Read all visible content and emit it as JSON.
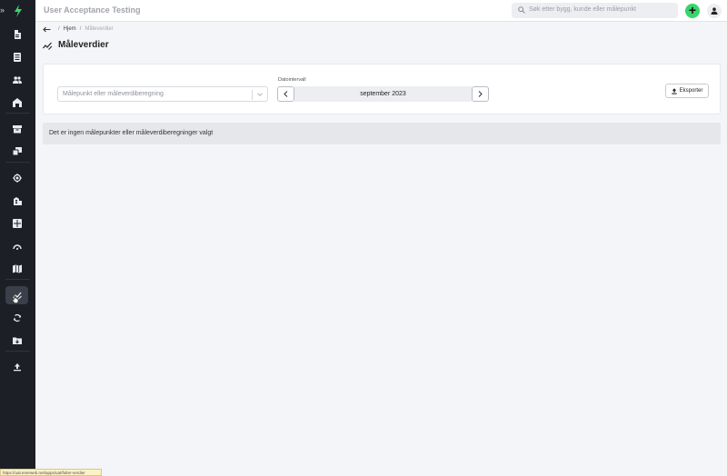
{
  "app": {
    "title": "User Acceptance Testing",
    "accent_color": "#3bd36c"
  },
  "search": {
    "placeholder": "Søk etter bygg, kunde eller målepunkt"
  },
  "topbar": {
    "add_label": "+"
  },
  "sidebar": {
    "expand_label": "»",
    "items": [
      {
        "icon": "document-icon"
      },
      {
        "icon": "list-icon"
      },
      {
        "icon": "people-icon"
      },
      {
        "icon": "building-icon"
      },
      {
        "icon": "archive-icon"
      },
      {
        "icon": "copy-icon"
      },
      {
        "icon": "target-icon"
      },
      {
        "icon": "buildings-icon"
      },
      {
        "icon": "grid-icon"
      },
      {
        "icon": "gauge-icon"
      },
      {
        "icon": "map-icon"
      },
      {
        "icon": "chart-line-icon",
        "active": true
      },
      {
        "icon": "sync-icon"
      },
      {
        "icon": "folder-icon"
      },
      {
        "icon": "upload-icon"
      }
    ]
  },
  "breadcrumb": {
    "home": "Hjem",
    "separator": "/",
    "current": "Måleverdier"
  },
  "page": {
    "title": "Måleverdier"
  },
  "filters": {
    "select_placeholder": "Målepunkt eller måleverdiberegning",
    "date_label": "Datointervall",
    "date_value": "september 2023",
    "export_label": "Eksporter"
  },
  "empty_message": "Det er ingen målepunkter eller måleverdiberegninger valgt",
  "status_url": "https://uat.enerweb.net/apps/uat/fulter-verdier"
}
